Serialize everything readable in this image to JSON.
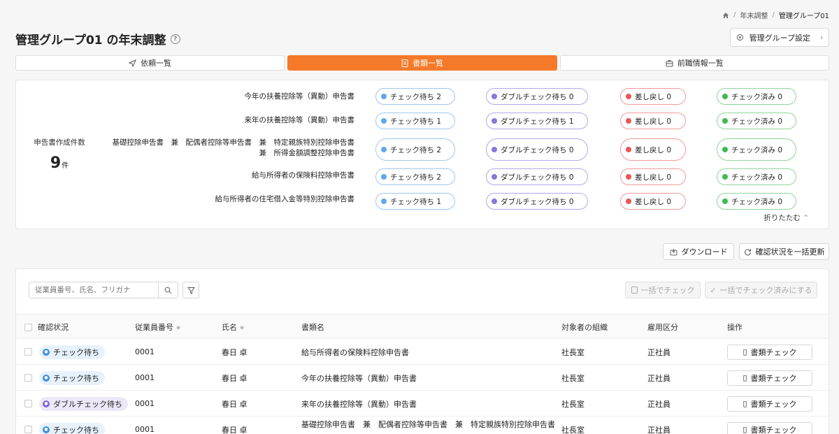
{
  "breadcrumb": {
    "items": [
      "年末調整",
      "管理グループ01"
    ]
  },
  "page": {
    "title": "管理グループ01 の年末調整"
  },
  "settings_button": {
    "label": "管理グループ設定"
  },
  "tabs": [
    {
      "label": "依頼一覧"
    },
    {
      "label": "書類一覧"
    },
    {
      "label": "前職情報一覧"
    }
  ],
  "summary": {
    "label": "申告書作成件数",
    "count": "9",
    "unit": "件",
    "fold_label": "折りたたむ",
    "rows": [
      {
        "line1": "今年の扶養控除等（異動）申告書",
        "line2": "",
        "check": "チェック待ち 2",
        "double": "ダブルチェック待ち 0",
        "back": "差し戻し 0",
        "done": "チェック済み 0"
      },
      {
        "line1": "来年の扶養控除等（異動）申告書",
        "line2": "",
        "check": "チェック待ち 1",
        "double": "ダブルチェック待ち 1",
        "back": "差し戻し 0",
        "done": "チェック済み 0"
      },
      {
        "line1": "基礎控除申告書　兼　配偶者控除等申告書　兼　特定親族特別控除申告書",
        "line2": "兼　所得金額調整控除申告書",
        "check": "チェック待ち 2",
        "double": "ダブルチェック待ち 0",
        "back": "差し戻し 0",
        "done": "チェック済み 0"
      },
      {
        "line1": "給与所得者の保険料控除申告書",
        "line2": "",
        "check": "チェック待ち 2",
        "double": "ダブルチェック待ち 0",
        "back": "差し戻し 0",
        "done": "チェック済み 0"
      },
      {
        "line1": "給与所得者の住宅借入金等特別控除申告書",
        "line2": "",
        "check": "チェック待ち 1",
        "double": "ダブルチェック待ち 0",
        "back": "差し戻し 0",
        "done": "チェック済み 0"
      }
    ]
  },
  "actions": {
    "download": "ダウンロード",
    "refresh": "確認状況を一括更新"
  },
  "search": {
    "placeholder": "従業員番号、氏名、フリガナ"
  },
  "bulk": {
    "check": "一括でチェック",
    "complete": "一括でチェック済みにする"
  },
  "table": {
    "headers": {
      "status": "確認状況",
      "employee_no": "従業員番号",
      "name": "氏名",
      "document": "書類名",
      "organization": "対象者の組織",
      "employment": "雇用区分",
      "operation": "操作"
    },
    "rows": [
      {
        "status": "チェック待ち",
        "status_type": "check",
        "employee_no": "0001",
        "name": "春日 卓",
        "document": "給与所得者の保険料控除申告書",
        "document2": "",
        "organization": "社長室",
        "employment": "正社員",
        "action": "書類チェック"
      },
      {
        "status": "チェック待ち",
        "status_type": "check",
        "employee_no": "0001",
        "name": "春日 卓",
        "document": "今年の扶養控除等（異動）申告書",
        "document2": "",
        "organization": "社長室",
        "employment": "正社員",
        "action": "書類チェック"
      },
      {
        "status": "ダブルチェック待ち",
        "status_type": "double",
        "employee_no": "0001",
        "name": "春日 卓",
        "document": "来年の扶養控除等（異動）申告書",
        "document2": "",
        "organization": "社長室",
        "employment": "正社員",
        "action": "書類チェック"
      },
      {
        "status": "チェック待ち",
        "status_type": "check",
        "employee_no": "0001",
        "name": "春日 卓",
        "document": "基礎控除申告書　兼　配偶者控除等申告書　兼　特定親族特別控除申告書",
        "document2": "",
        "organization": "社長室",
        "employment": "正社員",
        "action": "書類チェック"
      }
    ]
  }
}
